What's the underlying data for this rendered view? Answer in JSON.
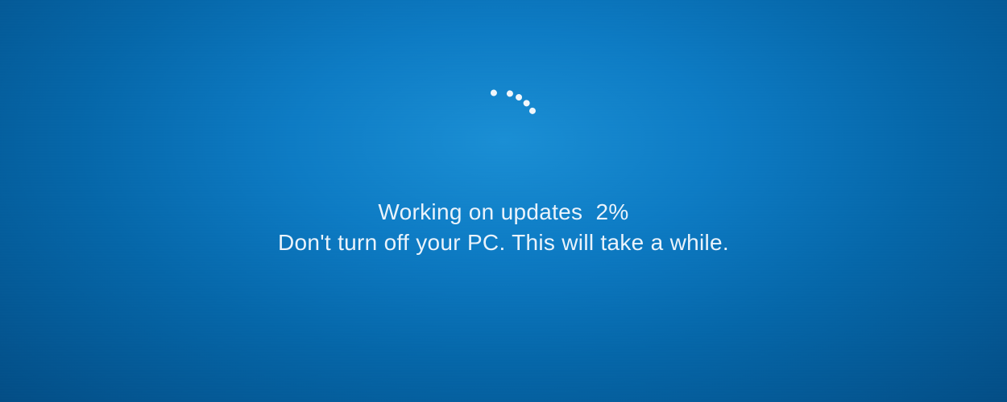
{
  "update": {
    "status_prefix": "Working on updates",
    "percent": "2%",
    "warning": "Don't turn off your PC. This will take a while."
  }
}
